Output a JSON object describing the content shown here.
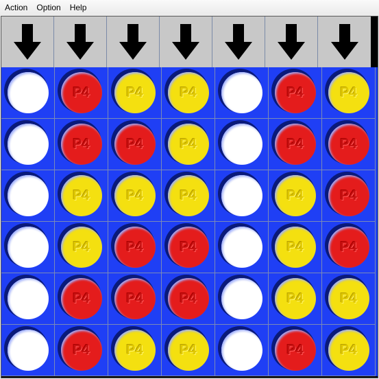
{
  "menu": {
    "items": [
      "Action",
      "Option",
      "Help"
    ]
  },
  "board": {
    "columns": 7,
    "rows": 6,
    "drop_icon": "arrow-down-icon",
    "disc_label": "P4",
    "colors": {
      "R": "#e41c1c",
      "Y": "#f4e010",
      "W": "#ffffff",
      "board": "#1f3ff5"
    },
    "cells": [
      [
        "W",
        "R",
        "Y",
        "Y",
        "W",
        "R",
        "Y"
      ],
      [
        "W",
        "R",
        "R",
        "Y",
        "W",
        "R",
        "R"
      ],
      [
        "W",
        "Y",
        "Y",
        "Y",
        "W",
        "Y",
        "R"
      ],
      [
        "W",
        "Y",
        "R",
        "R",
        "W",
        "Y",
        "R"
      ],
      [
        "W",
        "R",
        "R",
        "R",
        "W",
        "Y",
        "Y"
      ],
      [
        "W",
        "R",
        "Y",
        "Y",
        "W",
        "R",
        "Y"
      ]
    ]
  }
}
